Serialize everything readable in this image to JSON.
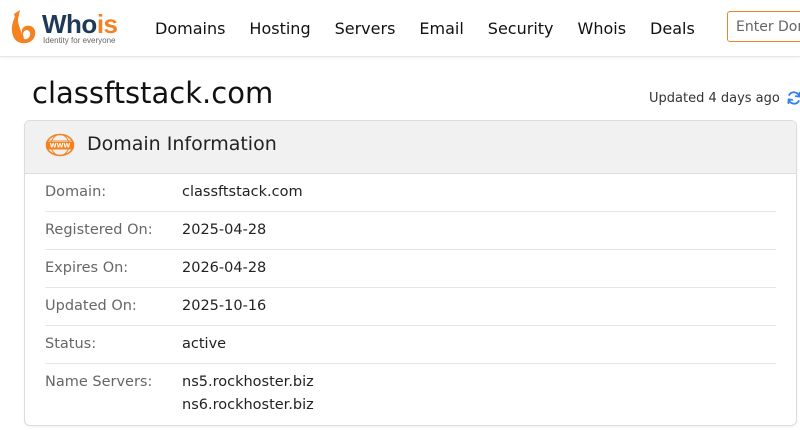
{
  "brand": {
    "name_part1": "Who",
    "name_part2": "is",
    "tagline": "Identity for everyone",
    "accent_color": "#f58220",
    "logo_icon": "whois-flame-logo-icon"
  },
  "nav": {
    "items": [
      "Domains",
      "Hosting",
      "Servers",
      "Email",
      "Security",
      "Whois",
      "Deals"
    ]
  },
  "search": {
    "placeholder": "Enter Domain"
  },
  "page": {
    "title": "classftstack.com",
    "updated_text": "Updated 4 days ago",
    "refresh_icon": "refresh-icon"
  },
  "card": {
    "title": "Domain Information",
    "icon": "www-icon",
    "rows": [
      {
        "label": "Domain:",
        "value": "classftstack.com"
      },
      {
        "label": "Registered On:",
        "value": "2025-04-28"
      },
      {
        "label": "Expires On:",
        "value": "2026-04-28"
      },
      {
        "label": "Updated On:",
        "value": "2025-10-16"
      },
      {
        "label": "Status:",
        "value": "active"
      },
      {
        "label": "Name Servers:",
        "values": [
          "ns5.rockhoster.biz",
          "ns6.rockhoster.biz"
        ]
      }
    ]
  }
}
